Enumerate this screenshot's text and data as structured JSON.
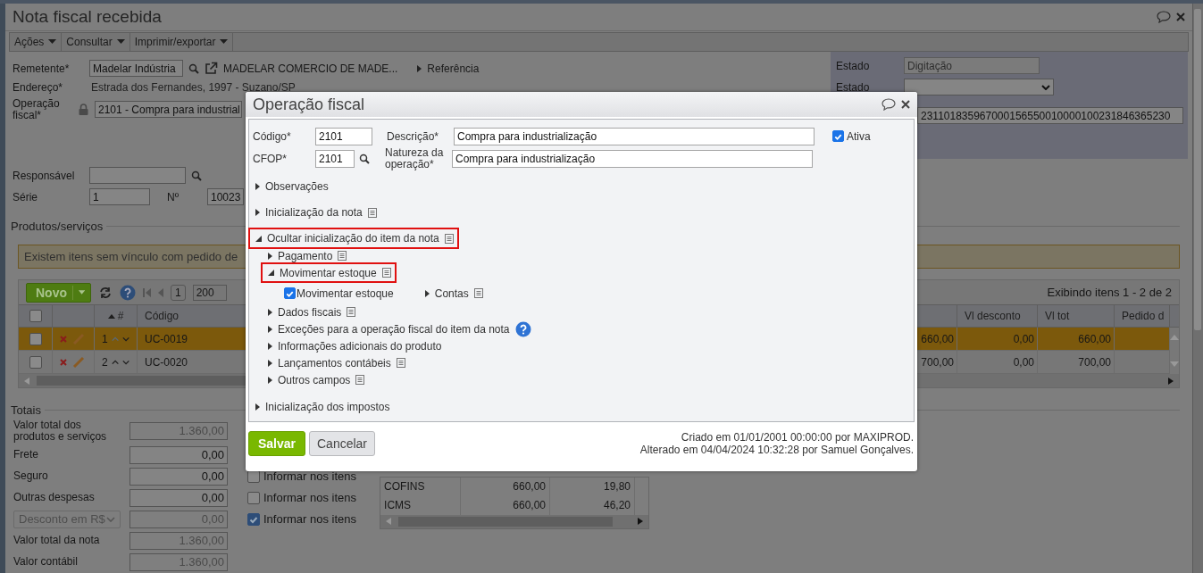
{
  "window": {
    "title": "Nota fiscal recebida"
  },
  "menu": [
    {
      "label": "Ações"
    },
    {
      "label": "Consultar"
    },
    {
      "label": "Imprimir/exportar"
    }
  ],
  "header": {
    "sender": {
      "label": "Remetente*",
      "value": "Madelar Indústria",
      "name": "MADELAR COMERCIO DE MADE...",
      "reference": "Referência"
    },
    "address": {
      "label": "Endereço*",
      "value": "Estrada dos Fernandes, 1997 - Suzano/SP"
    },
    "operation": {
      "label": "Operação fiscal*",
      "value": "2101 - Compra para industrial"
    },
    "responsible": {
      "label": "Responsável"
    },
    "series": {
      "label": "Série",
      "value": "1"
    },
    "number": {
      "label": "Nº",
      "value": "10023"
    }
  },
  "status_panel": {
    "state": {
      "label": "Estado",
      "value": "Digitação"
    },
    "state_select": {
      "label": "Estado"
    },
    "key": "231101835967000156550010000100231846365230"
  },
  "products": {
    "title": "Produtos/serviços",
    "warning": "Existem itens sem vínculo com pedido de",
    "new_button": "Novo",
    "page": "1",
    "page_size": "200",
    "summary": "Exibindo itens 1 - 2 de 2",
    "all_checked": false,
    "columns": [
      "#",
      "Código",
      "Vl desconto",
      "Vl tot",
      "Pedido d"
    ],
    "rows": [
      {
        "index": "1",
        "code": "UC-0019",
        "item_value": "660,00",
        "discount": "0,00",
        "total": "660,00",
        "can_move_up": false,
        "checked": false,
        "selected": true
      },
      {
        "index": "2",
        "code": "UC-0020",
        "item_value": "700,00",
        "discount": "0,00",
        "total": "700,00",
        "can_move_up": true,
        "checked": false,
        "selected": false
      }
    ]
  },
  "totals": {
    "title": "Totais",
    "fields": [
      {
        "kind": "text",
        "label": "Valor total dos produtos e serviços",
        "value": "1.360,00",
        "disabled": true
      },
      {
        "kind": "text",
        "label": "Frete",
        "value": "0,00",
        "disabled": false
      },
      {
        "kind": "text",
        "label": "Seguro",
        "value": "0,00",
        "disabled": false
      },
      {
        "kind": "text",
        "label": "Outras despesas",
        "value": "0,00",
        "disabled": false
      },
      {
        "kind": "select",
        "label": "Desconto em R$",
        "value": "0,00",
        "disabled": true
      },
      {
        "kind": "text",
        "label": "Valor total da nota",
        "value": "1.360,00",
        "disabled": true
      },
      {
        "kind": "text",
        "label": "Valor contábil",
        "value": "1.360,00",
        "disabled": true
      }
    ],
    "item_flags": [
      {
        "label": "Informar nos itens",
        "checked": false
      },
      {
        "label": "Informar nos itens",
        "checked": false
      },
      {
        "label": "Informar nos itens",
        "checked": true
      }
    ],
    "taxes": [
      {
        "name": "COFINS",
        "base": "660,00",
        "value": "19,80"
      },
      {
        "name": "ICMS",
        "base": "660,00",
        "value": "46,20"
      }
    ]
  },
  "dialog": {
    "title": "Operação fiscal",
    "code": {
      "label": "Código*",
      "value": "2101"
    },
    "description": {
      "label": "Descrição*",
      "value": "Compra para industrialização"
    },
    "active": {
      "label": "Ativa",
      "checked": true
    },
    "cfop": {
      "label": "CFOP*",
      "value": "2101"
    },
    "nature": {
      "label": "Natureza da operação*",
      "value": "Compra para industrialização"
    },
    "sections": [
      {
        "kind": "plain",
        "label": "Observações",
        "expanded": false,
        "highlighted": false
      },
      {
        "kind": "noted",
        "label": "Inicialização da nota",
        "expanded": false,
        "highlighted": false
      },
      {
        "kind": "noted",
        "label": "Ocultar inicialização do item da nota",
        "expanded": true,
        "highlighted": true,
        "children": [
          {
            "kind": "noted",
            "label": "Pagamento",
            "expanded": false,
            "highlighted": false
          },
          {
            "kind": "noted",
            "label": "Movimentar estoque",
            "expanded": true,
            "highlighted": true,
            "children": [
              {
                "kind": "checkbox",
                "label": "Movimentar estoque",
                "checked": true
              },
              {
                "kind": "noted",
                "label": "Contas",
                "expanded": false,
                "highlighted": false
              }
            ]
          },
          {
            "kind": "noted",
            "label": "Dados fiscais",
            "expanded": false,
            "highlighted": false
          },
          {
            "kind": "help",
            "label": "Exceções para a operação fiscal do item da nota",
            "expanded": false,
            "highlighted": false
          },
          {
            "kind": "plain",
            "label": "Informações adicionais do produto",
            "expanded": false,
            "highlighted": false
          },
          {
            "kind": "noted",
            "label": "Lançamentos contábeis",
            "expanded": false,
            "highlighted": false
          },
          {
            "kind": "noted",
            "label": "Outros campos",
            "expanded": false,
            "highlighted": false
          }
        ]
      },
      {
        "kind": "plain",
        "label": "Inicialização dos impostos",
        "expanded": false,
        "highlighted": false
      }
    ],
    "buttons": [
      {
        "label": "Salvar",
        "kind": "primary"
      },
      {
        "label": "Cancelar",
        "kind": "secondary"
      }
    ],
    "created": "Criado em 01/01/2001 00:00:00 por MAXIPROD.",
    "modified": "Alterado em 04/04/2024 10:32:28 por Samuel Gonçalves."
  }
}
